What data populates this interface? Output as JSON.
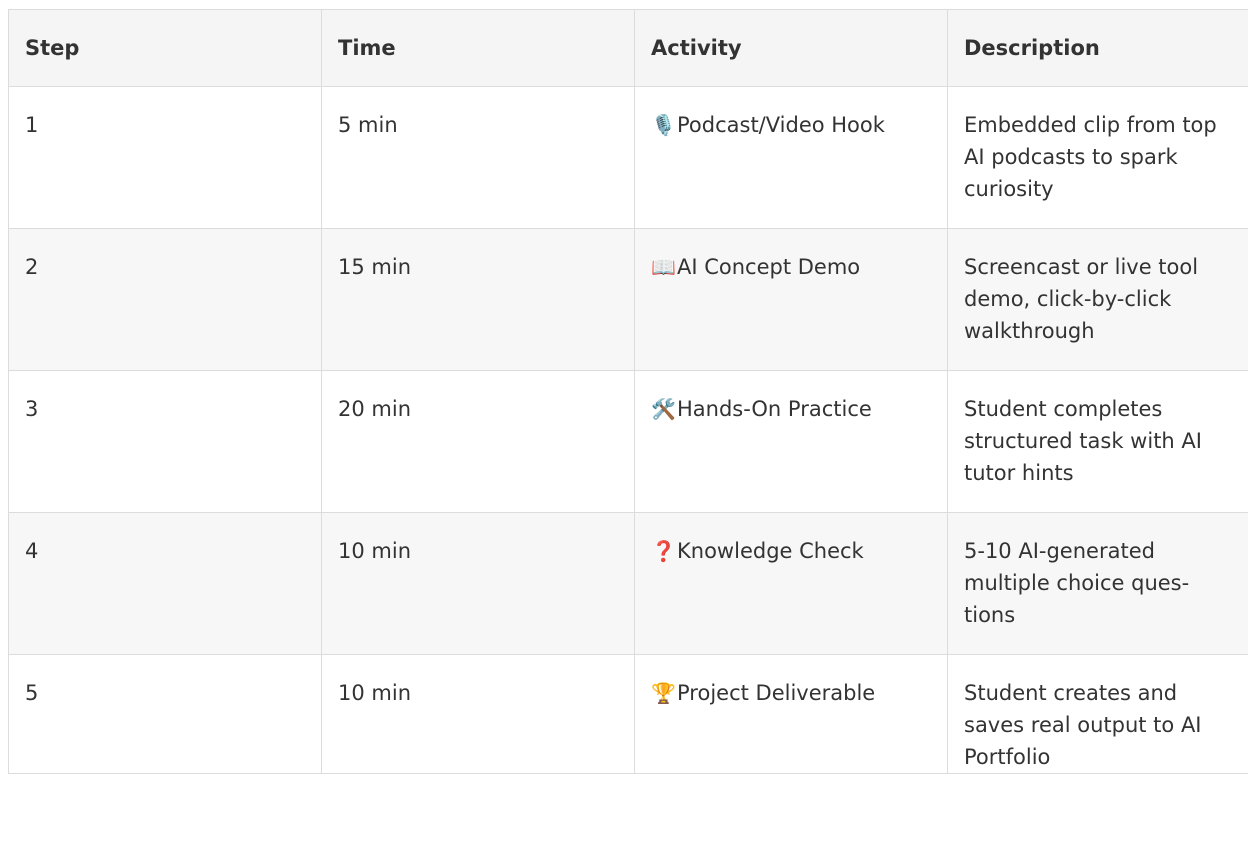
{
  "table": {
    "headers": [
      "Step",
      "Time",
      "Activity",
      "Description"
    ],
    "rows": [
      {
        "step": "1",
        "time": "5 min",
        "icon": "microphone-icon",
        "icon_glyph": "🎙️",
        "activity": "Podcast/Video Hook",
        "description": "Embedded clip from top AI podcasts to spark curiosity"
      },
      {
        "step": "2",
        "time": "15 min",
        "icon": "open-book-icon",
        "icon_glyph": "📖",
        "activity": "AI Concept Demo",
        "description": "Screencast or live tool demo, click-by-click walkthrough"
      },
      {
        "step": "3",
        "time": "20 min",
        "icon": "hammer-wrench-icon",
        "icon_glyph": "🛠️",
        "activity": "Hands-On Practice",
        "description": "Student completes structured task with AI tutor hints"
      },
      {
        "step": "4",
        "time": "10 min",
        "icon": "question-mark-icon",
        "icon_glyph": "❓",
        "activity": "Knowledge Check",
        "description": "5-10 AI-generated multiple choice ques-tions"
      },
      {
        "step": "5",
        "time": "10 min",
        "icon": "trophy-icon",
        "icon_glyph": "🏆",
        "activity": "Project Deliverable",
        "description": "Student creates and saves real output to AI Portfolio"
      }
    ]
  }
}
